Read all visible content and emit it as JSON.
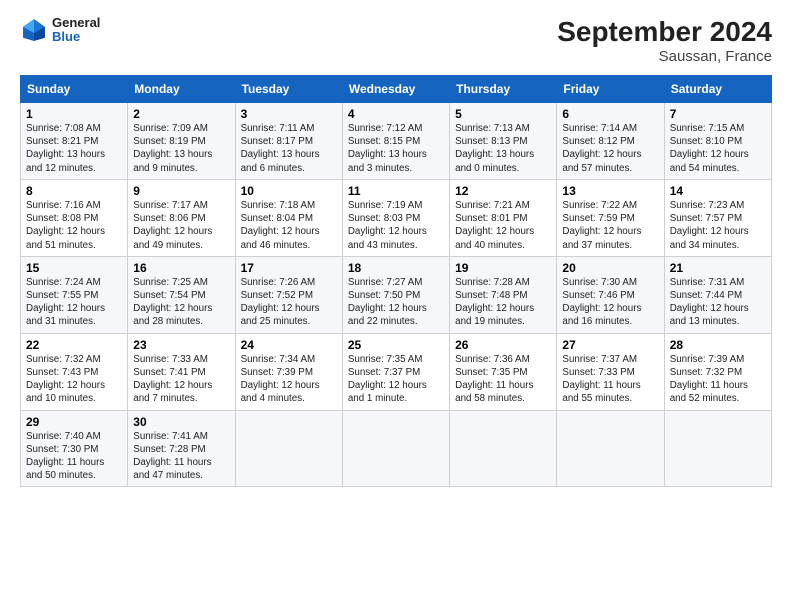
{
  "logo": {
    "general": "General",
    "blue": "Blue"
  },
  "title": "September 2024",
  "subtitle": "Saussan, France",
  "days_of_week": [
    "Sunday",
    "Monday",
    "Tuesday",
    "Wednesday",
    "Thursday",
    "Friday",
    "Saturday"
  ],
  "weeks": [
    [
      {
        "day": "1",
        "sunrise": "Sunrise: 7:08 AM",
        "sunset": "Sunset: 8:21 PM",
        "daylight": "Daylight: 13 hours and 12 minutes."
      },
      {
        "day": "2",
        "sunrise": "Sunrise: 7:09 AM",
        "sunset": "Sunset: 8:19 PM",
        "daylight": "Daylight: 13 hours and 9 minutes."
      },
      {
        "day": "3",
        "sunrise": "Sunrise: 7:11 AM",
        "sunset": "Sunset: 8:17 PM",
        "daylight": "Daylight: 13 hours and 6 minutes."
      },
      {
        "day": "4",
        "sunrise": "Sunrise: 7:12 AM",
        "sunset": "Sunset: 8:15 PM",
        "daylight": "Daylight: 13 hours and 3 minutes."
      },
      {
        "day": "5",
        "sunrise": "Sunrise: 7:13 AM",
        "sunset": "Sunset: 8:13 PM",
        "daylight": "Daylight: 13 hours and 0 minutes."
      },
      {
        "day": "6",
        "sunrise": "Sunrise: 7:14 AM",
        "sunset": "Sunset: 8:12 PM",
        "daylight": "Daylight: 12 hours and 57 minutes."
      },
      {
        "day": "7",
        "sunrise": "Sunrise: 7:15 AM",
        "sunset": "Sunset: 8:10 PM",
        "daylight": "Daylight: 12 hours and 54 minutes."
      }
    ],
    [
      {
        "day": "8",
        "sunrise": "Sunrise: 7:16 AM",
        "sunset": "Sunset: 8:08 PM",
        "daylight": "Daylight: 12 hours and 51 minutes."
      },
      {
        "day": "9",
        "sunrise": "Sunrise: 7:17 AM",
        "sunset": "Sunset: 8:06 PM",
        "daylight": "Daylight: 12 hours and 49 minutes."
      },
      {
        "day": "10",
        "sunrise": "Sunrise: 7:18 AM",
        "sunset": "Sunset: 8:04 PM",
        "daylight": "Daylight: 12 hours and 46 minutes."
      },
      {
        "day": "11",
        "sunrise": "Sunrise: 7:19 AM",
        "sunset": "Sunset: 8:03 PM",
        "daylight": "Daylight: 12 hours and 43 minutes."
      },
      {
        "day": "12",
        "sunrise": "Sunrise: 7:21 AM",
        "sunset": "Sunset: 8:01 PM",
        "daylight": "Daylight: 12 hours and 40 minutes."
      },
      {
        "day": "13",
        "sunrise": "Sunrise: 7:22 AM",
        "sunset": "Sunset: 7:59 PM",
        "daylight": "Daylight: 12 hours and 37 minutes."
      },
      {
        "day": "14",
        "sunrise": "Sunrise: 7:23 AM",
        "sunset": "Sunset: 7:57 PM",
        "daylight": "Daylight: 12 hours and 34 minutes."
      }
    ],
    [
      {
        "day": "15",
        "sunrise": "Sunrise: 7:24 AM",
        "sunset": "Sunset: 7:55 PM",
        "daylight": "Daylight: 12 hours and 31 minutes."
      },
      {
        "day": "16",
        "sunrise": "Sunrise: 7:25 AM",
        "sunset": "Sunset: 7:54 PM",
        "daylight": "Daylight: 12 hours and 28 minutes."
      },
      {
        "day": "17",
        "sunrise": "Sunrise: 7:26 AM",
        "sunset": "Sunset: 7:52 PM",
        "daylight": "Daylight: 12 hours and 25 minutes."
      },
      {
        "day": "18",
        "sunrise": "Sunrise: 7:27 AM",
        "sunset": "Sunset: 7:50 PM",
        "daylight": "Daylight: 12 hours and 22 minutes."
      },
      {
        "day": "19",
        "sunrise": "Sunrise: 7:28 AM",
        "sunset": "Sunset: 7:48 PM",
        "daylight": "Daylight: 12 hours and 19 minutes."
      },
      {
        "day": "20",
        "sunrise": "Sunrise: 7:30 AM",
        "sunset": "Sunset: 7:46 PM",
        "daylight": "Daylight: 12 hours and 16 minutes."
      },
      {
        "day": "21",
        "sunrise": "Sunrise: 7:31 AM",
        "sunset": "Sunset: 7:44 PM",
        "daylight": "Daylight: 12 hours and 13 minutes."
      }
    ],
    [
      {
        "day": "22",
        "sunrise": "Sunrise: 7:32 AM",
        "sunset": "Sunset: 7:43 PM",
        "daylight": "Daylight: 12 hours and 10 minutes."
      },
      {
        "day": "23",
        "sunrise": "Sunrise: 7:33 AM",
        "sunset": "Sunset: 7:41 PM",
        "daylight": "Daylight: 12 hours and 7 minutes."
      },
      {
        "day": "24",
        "sunrise": "Sunrise: 7:34 AM",
        "sunset": "Sunset: 7:39 PM",
        "daylight": "Daylight: 12 hours and 4 minutes."
      },
      {
        "day": "25",
        "sunrise": "Sunrise: 7:35 AM",
        "sunset": "Sunset: 7:37 PM",
        "daylight": "Daylight: 12 hours and 1 minute."
      },
      {
        "day": "26",
        "sunrise": "Sunrise: 7:36 AM",
        "sunset": "Sunset: 7:35 PM",
        "daylight": "Daylight: 11 hours and 58 minutes."
      },
      {
        "day": "27",
        "sunrise": "Sunrise: 7:37 AM",
        "sunset": "Sunset: 7:33 PM",
        "daylight": "Daylight: 11 hours and 55 minutes."
      },
      {
        "day": "28",
        "sunrise": "Sunrise: 7:39 AM",
        "sunset": "Sunset: 7:32 PM",
        "daylight": "Daylight: 11 hours and 52 minutes."
      }
    ],
    [
      {
        "day": "29",
        "sunrise": "Sunrise: 7:40 AM",
        "sunset": "Sunset: 7:30 PM",
        "daylight": "Daylight: 11 hours and 50 minutes."
      },
      {
        "day": "30",
        "sunrise": "Sunrise: 7:41 AM",
        "sunset": "Sunset: 7:28 PM",
        "daylight": "Daylight: 11 hours and 47 minutes."
      },
      null,
      null,
      null,
      null,
      null
    ]
  ]
}
